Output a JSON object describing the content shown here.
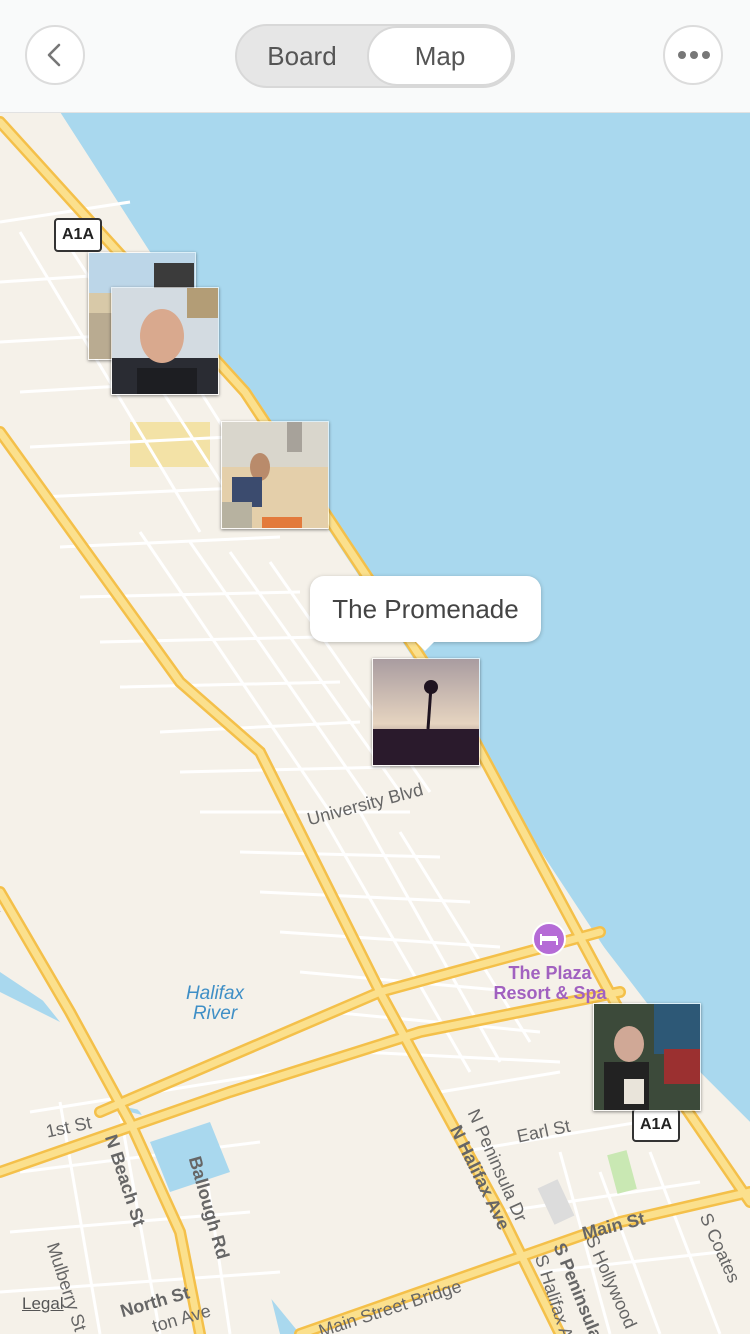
{
  "header": {
    "back_icon": "chevron-left-icon",
    "segments": [
      "Board",
      "Map"
    ],
    "selected_segment": "Map",
    "more_icon": "ellipsis-icon"
  },
  "map": {
    "callout": "The Promenade",
    "route_shields": [
      "A1A",
      "A1A"
    ],
    "poi": {
      "name_line1": "The Plaza",
      "name_line2": "Resort & Spa",
      "icon": "hotel-bed-icon",
      "color": "#b56bd6"
    },
    "water": {
      "line1": "Halifax",
      "line2": "River"
    },
    "streets": {
      "university": "University Blvd",
      "first": "1st St",
      "nbeach": "N Beach St",
      "ballough": "Ballough Rd",
      "mulberry": "Mulberry St",
      "north": "North St",
      "earl": "Earl St",
      "nhalifax": "N Halifax Ave",
      "npeninsula": "N Peninsula Dr",
      "main": "Main St",
      "speninsula": "S Peninsula",
      "shalifax": "S Halifax Ave",
      "shollywood": "S Hollywood",
      "scoates": "S Coates",
      "mainbridge": "Main Street Bridge",
      "avecut": "ton Ave",
      "dr_cut": "Dr"
    },
    "photos": [
      {
        "id": "beach-crowd",
        "desc": "beach photo"
      },
      {
        "id": "man-portrait",
        "desc": "portrait photo"
      },
      {
        "id": "beach-bike",
        "desc": "bike on beach"
      },
      {
        "id": "palm-sunset",
        "desc": "palm silhouette"
      },
      {
        "id": "friends-drinks",
        "desc": "patio photo"
      }
    ],
    "legal": "Legal",
    "colors": {
      "water": "#a9d8ee",
      "land": "#f5f1e9",
      "road_major": "#f8d15e",
      "road_minor": "#ffffff"
    }
  }
}
